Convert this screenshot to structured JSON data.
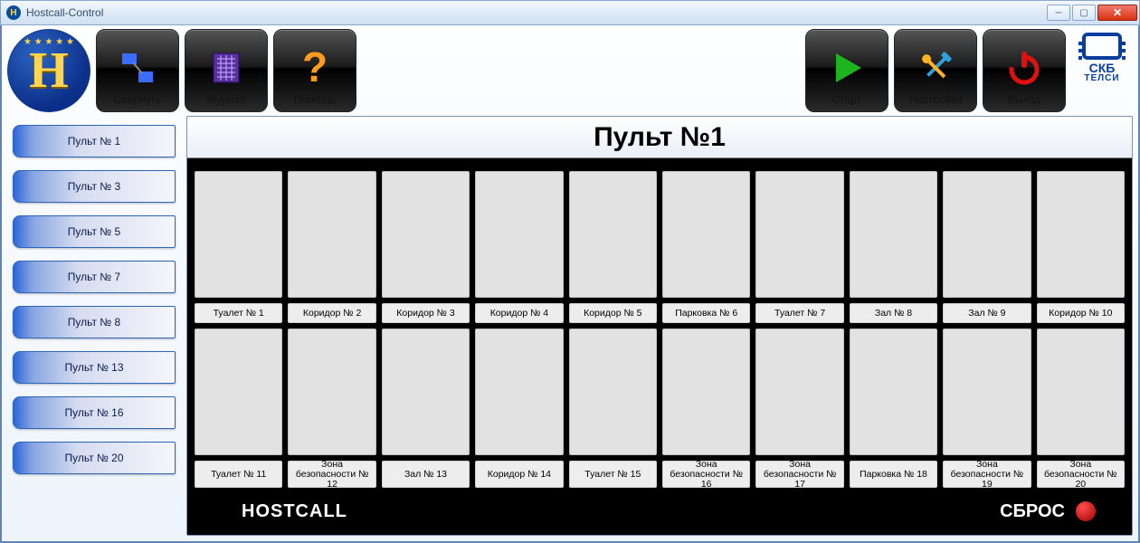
{
  "window": {
    "title": "Hostcall-Control"
  },
  "toolbar": {
    "minimize": "Свернуть",
    "journal": "Журнал",
    "help": "Помощь",
    "start": "Старт",
    "settings": "Настройки",
    "exit": "Выход"
  },
  "brand": {
    "name": "СКБ",
    "sub": "ТЕЛСИ"
  },
  "sidebar": {
    "items": [
      "Пульт № 1",
      "Пульт № 3",
      "Пульт № 5",
      "Пульт № 7",
      "Пульт № 8",
      "Пульт № 13",
      "Пульт № 16",
      "Пульт № 20"
    ]
  },
  "panel": {
    "title": "Пульт №1",
    "footer_left": "HOSTCALL",
    "footer_reset": "СБРОС",
    "zones_row1": [
      "Туалет № 1",
      "Коридор № 2",
      "Коридор № 3",
      "Коридор № 4",
      "Коридор № 5",
      "Парковка № 6",
      "Туалет № 7",
      "Зал № 8",
      "Зал № 9",
      "Коридор № 10"
    ],
    "zones_row2": [
      "Туалет № 11",
      "Зона безопасности № 12",
      "Зал № 13",
      "Коридор № 14",
      "Туалет № 15",
      "Зона безопасности № 16",
      "Зона безопасности № 17",
      "Парковка № 18",
      "Зона безопасности № 19",
      "Зона безопасности № 20"
    ]
  }
}
